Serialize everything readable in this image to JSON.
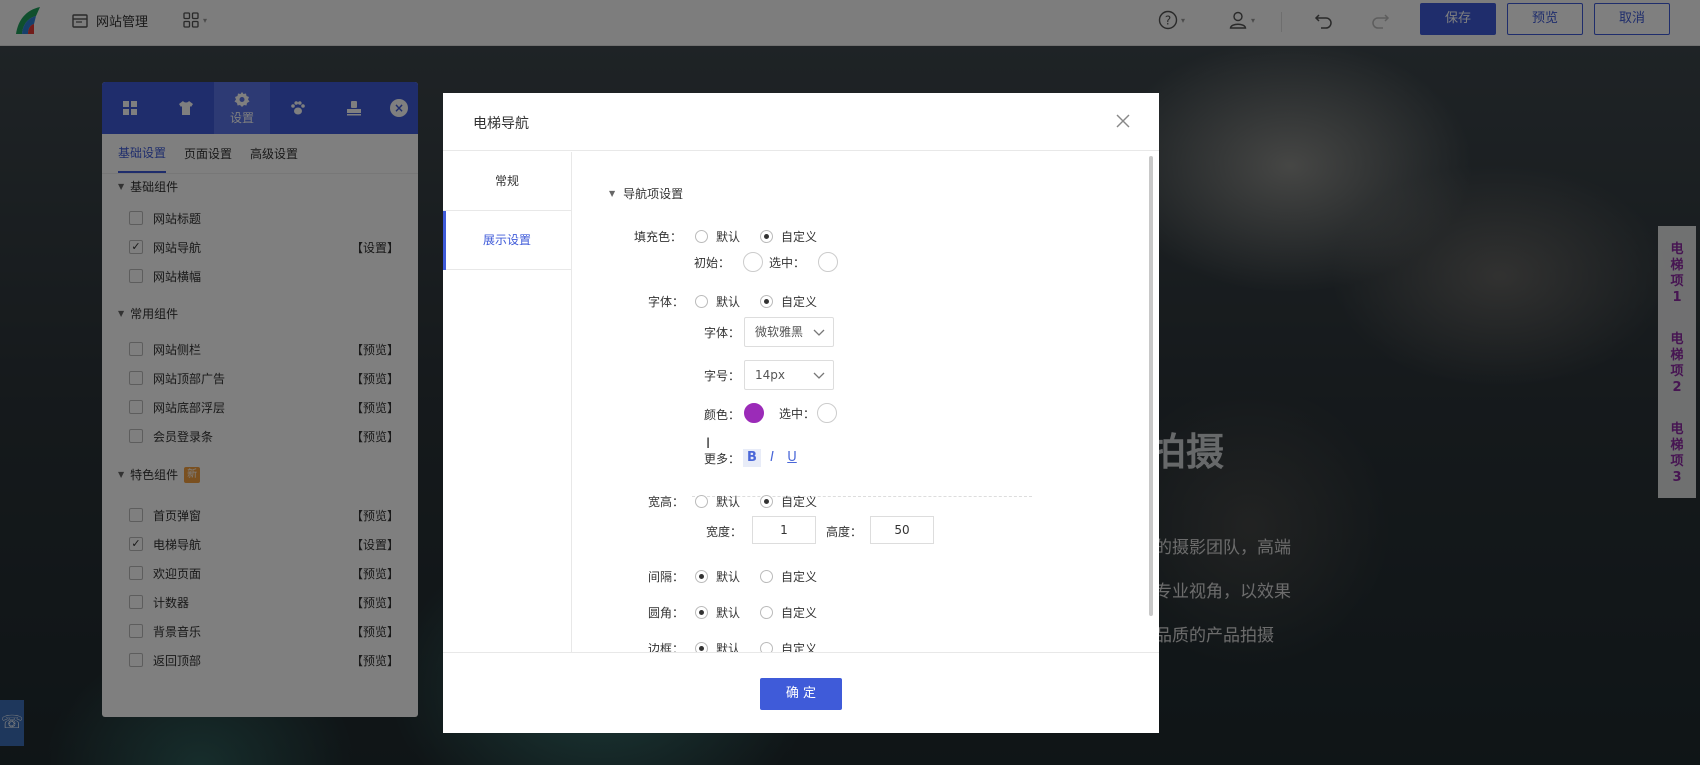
{
  "topbar": {
    "site_label": "网站管理",
    "save": "保存",
    "preview": "预览",
    "cancel": "取消"
  },
  "stage": {
    "headline": "拍摄",
    "lines": [
      "的摄影团队，高端",
      "专业视角，以效果",
      "品质的产品拍摄"
    ],
    "elevator": [
      "电梯项1",
      "电梯项2",
      "电梯项3"
    ]
  },
  "panel": {
    "tabs": [
      {
        "icon": "grid-icon"
      },
      {
        "icon": "shirt-icon"
      },
      {
        "icon": "gear-icon",
        "label": "设置"
      },
      {
        "icon": "paw-icon"
      },
      {
        "icon": "stamp-icon"
      }
    ],
    "subtabs": [
      "基础设置",
      "页面设置",
      "高级设置"
    ],
    "groups": [
      {
        "title": "基础组件",
        "items": [
          {
            "name": "网站标题",
            "checked": false,
            "action": ""
          },
          {
            "name": "网站导航",
            "checked": true,
            "action": "【设置】"
          },
          {
            "name": "网站横幅",
            "checked": false,
            "action": ""
          }
        ]
      },
      {
        "title": "常用组件",
        "items": [
          {
            "name": "网站侧栏",
            "checked": false,
            "action": "【预览】"
          },
          {
            "name": "网站顶部广告",
            "checked": false,
            "action": "【预览】"
          },
          {
            "name": "网站底部浮层",
            "checked": false,
            "action": "【预览】"
          },
          {
            "name": "会员登录条",
            "checked": false,
            "action": "【预览】"
          }
        ]
      },
      {
        "title": "特色组件",
        "badge": "新",
        "items": [
          {
            "name": "首页弹窗",
            "checked": false,
            "action": "【预览】"
          },
          {
            "name": "电梯导航",
            "checked": true,
            "action": "【设置】"
          },
          {
            "name": "欢迎页面",
            "checked": false,
            "action": "【预览】"
          },
          {
            "name": "计数器",
            "checked": false,
            "action": "【预览】"
          },
          {
            "name": "背景音乐",
            "checked": false,
            "action": "【预览】"
          },
          {
            "name": "返回顶部",
            "checked": false,
            "action": "【预览】"
          }
        ]
      }
    ]
  },
  "modal": {
    "title": "电梯导航",
    "side": [
      "常规",
      "展示设置"
    ],
    "section": "导航项设置",
    "fill": {
      "label": "填充色：",
      "opt_default": "默认",
      "opt_custom": "自定义",
      "initial": "初始：",
      "selected": "选中："
    },
    "font": {
      "label": "字体：",
      "opt_default": "默认",
      "opt_custom": "自定义",
      "family_label": "字体：",
      "family_value": "微软雅黑",
      "size_label": "字号：",
      "size_value": "14px",
      "color_label": "颜色：",
      "color_selected": "选中：",
      "color_value": "#9b2bb8",
      "more_label": "更多：",
      "bold": "B",
      "italic": "I",
      "underline": "U"
    },
    "size": {
      "label": "宽高：",
      "opt_default": "默认",
      "opt_custom": "自定义",
      "w_label": "宽度：",
      "w_value": "1",
      "h_label": "高度：",
      "h_value": "50"
    },
    "spacing": {
      "label": "间隔：",
      "opt_default": "默认",
      "opt_custom": "自定义"
    },
    "radius": {
      "label": "圆角：",
      "opt_default": "默认",
      "opt_custom": "自定义"
    },
    "border": {
      "label": "边框：",
      "opt_default": "默认",
      "opt_custom": "自定义"
    },
    "ok": "确 定"
  }
}
